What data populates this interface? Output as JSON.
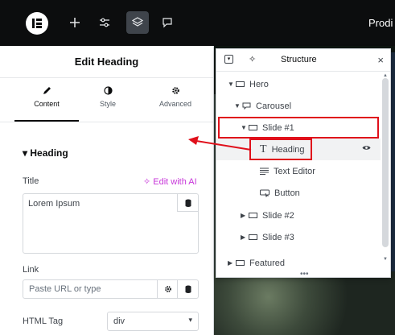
{
  "topbar": {
    "site_name": "Prodi",
    "icons": [
      "elementor-logo",
      "plus-icon",
      "sliders-icon",
      "layers-icon",
      "comment-icon"
    ]
  },
  "panel": {
    "title": "Edit Heading",
    "tabs": [
      {
        "label": "Content",
        "icon": "pencil-icon",
        "active": true
      },
      {
        "label": "Style",
        "icon": "half-circle-icon",
        "active": false
      },
      {
        "label": "Advanced",
        "icon": "gear-icon",
        "active": false
      }
    ],
    "section_title": "Heading",
    "title_label": "Title",
    "ai_link": "Edit with AI",
    "title_value": "Lorem Ipsum",
    "link_label": "Link",
    "link_placeholder": "Paste URL or type",
    "html_tag_label": "HTML Tag",
    "html_tag_value": "div"
  },
  "structure": {
    "title": "Structure",
    "close": "×",
    "items": [
      {
        "label": "Hero",
        "expanded": true,
        "icon": "container-icon"
      },
      {
        "label": "Carousel",
        "expanded": true,
        "icon": "carousel-icon"
      },
      {
        "label": "Slide #1",
        "expanded": true,
        "icon": "container-icon"
      },
      {
        "label": "Heading",
        "icon": "heading-icon",
        "selected": true
      },
      {
        "label": "Text Editor",
        "icon": "text-editor-icon"
      },
      {
        "label": "Button",
        "icon": "button-icon"
      },
      {
        "label": "Slide #2",
        "expanded": false,
        "icon": "container-icon"
      },
      {
        "label": "Slide #3",
        "expanded": false,
        "icon": "container-icon"
      },
      {
        "label": "Featured",
        "expanded": false,
        "icon": "container-icon"
      }
    ]
  },
  "colors": {
    "highlight": "#e0101b",
    "ai_accent": "#c736d9",
    "topbar_bg": "#0c0d0e"
  }
}
